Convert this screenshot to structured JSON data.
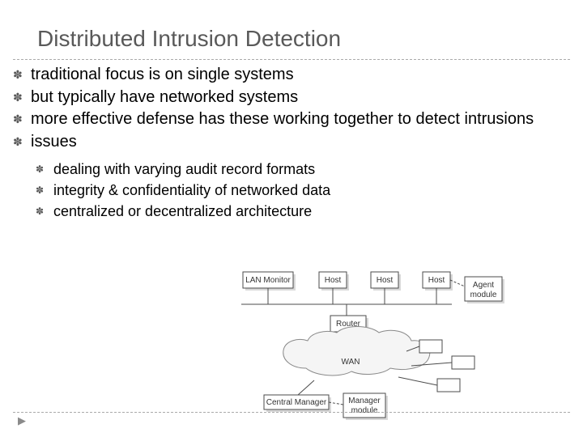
{
  "title": "Distributed Intrusion Detection",
  "bullets": [
    {
      "text": "traditional focus is on single systems"
    },
    {
      "text": "but typically have networked systems"
    },
    {
      "text": "more effective defense has these working together to detect intrusions"
    },
    {
      "text": "issues",
      "sub": [
        "dealing with varying audit record formats",
        "integrity & confidentiality of networked data",
        "centralized or decentralized architecture"
      ]
    }
  ],
  "diagram": {
    "lan_monitor": "LAN Monitor",
    "host": "Host",
    "agent_module": "Agent module",
    "router": "Router",
    "wan": "WAN",
    "central_manager": "Central Manager",
    "manager_module": "Manager module"
  },
  "glyphs": {
    "bullet": "✽",
    "footer_arrow": "▶"
  }
}
